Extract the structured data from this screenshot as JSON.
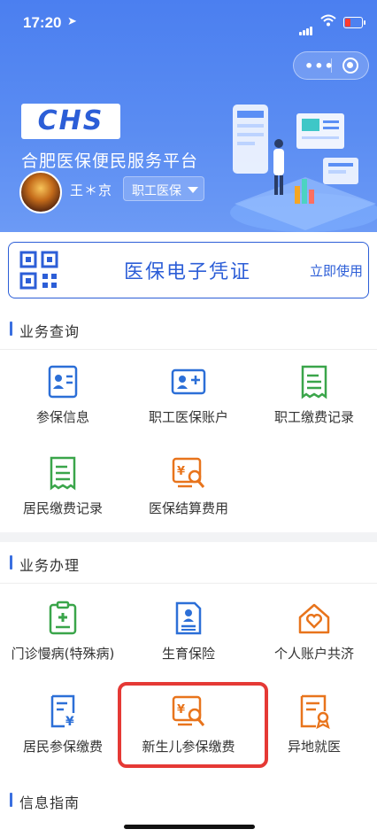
{
  "status_bar": {
    "time": "17:20"
  },
  "header": {
    "logo_text": "CHS",
    "platform_title": "合肥医保便民服务平台",
    "user_name": "王＊京",
    "insurance_type": "职工医保"
  },
  "certificate": {
    "title": "医保电子凭证",
    "action": "立即使用"
  },
  "sections": {
    "query": {
      "title": "业务查询",
      "items": [
        "参保信息",
        "职工医保账户",
        "职工缴费记录",
        "居民缴费记录",
        "医保结算费用"
      ]
    },
    "handle": {
      "title": "业务办理",
      "items": [
        "门诊慢病(特殊病)",
        "生育保险",
        "个人账户共济",
        "居民参保缴费",
        "新生儿参保缴费",
        "异地就医"
      ]
    },
    "guide": {
      "title": "信息指南"
    }
  },
  "colors": {
    "header_blue": "#4b7ff0",
    "brand_blue": "#2c5ed7",
    "icon_green": "#3aa54a",
    "icon_orange": "#e8741c",
    "highlight_red": "#e53935"
  }
}
